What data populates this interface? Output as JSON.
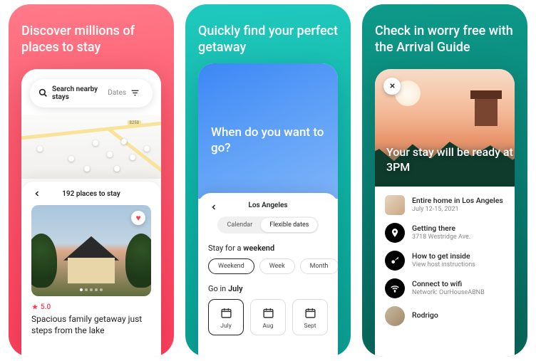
{
  "s1": {
    "headline": "Discover millions of places to stay",
    "search_text": "Search nearby stays",
    "dates_label": "Dates",
    "roadnum": "8258",
    "sheet_title": "192 places to stay",
    "rating": "5.0",
    "listing_title": "Spacious family getaway just steps from the lake"
  },
  "s2": {
    "headline": "Quickly find your perfect getaway",
    "hero_q": "When do you want to go?",
    "location": "Los Angeles",
    "seg": {
      "calendar": "Calendar",
      "flex": "Flexible dates"
    },
    "stay_label_pre": "Stay for a ",
    "stay_label_b": "weekend",
    "chips": {
      "weekend": "Weekend",
      "week": "Week",
      "month": "Month"
    },
    "go_label_pre": "Go in ",
    "go_label_b": "July",
    "months": {
      "jul": "July",
      "aug": "Aug",
      "sep": "Sept"
    }
  },
  "s3": {
    "headline": "Check in worry free with the Arrival Guide",
    "hero_overlay": "Your stay will be ready at 3PM",
    "items": [
      {
        "title": "Entire home in Los Angeles",
        "sub": "July 12-15, 2021"
      },
      {
        "title": "Getting there",
        "sub": "3718 Westridge Ave."
      },
      {
        "title": "How to get inside",
        "sub": "View host instructions"
      },
      {
        "title": "Connect to wifi",
        "sub": "Network: OurHouseABNB"
      },
      {
        "title": "Rodrigo",
        "sub": ""
      }
    ]
  }
}
